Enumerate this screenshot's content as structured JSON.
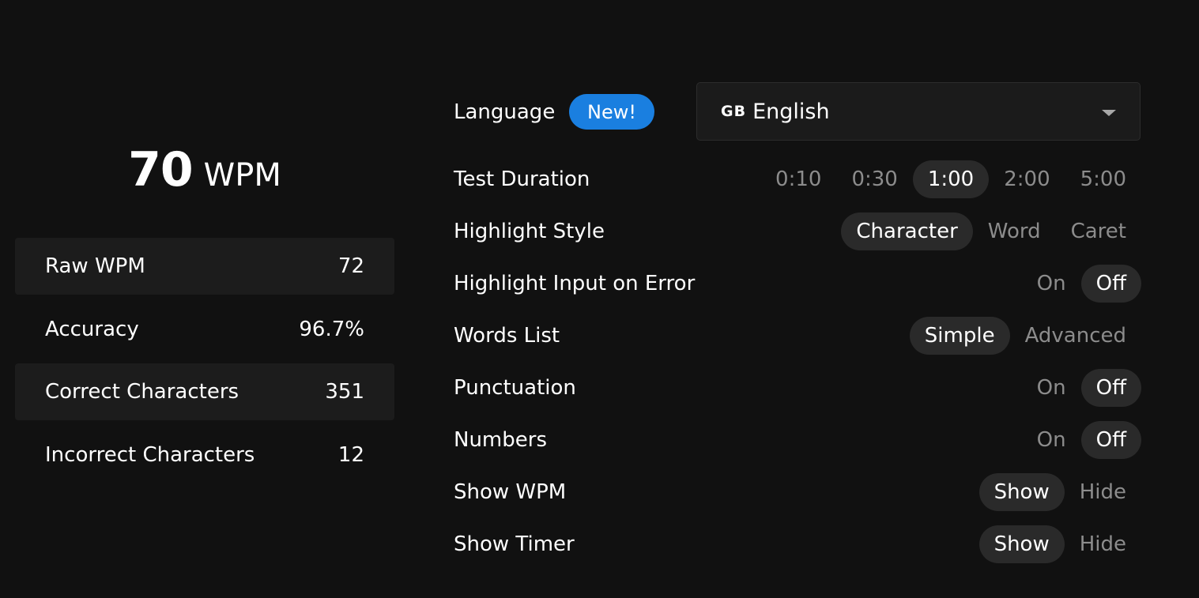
{
  "results": {
    "wpm_value": "70",
    "wpm_unit": "WPM",
    "stats": [
      {
        "label": "Raw WPM",
        "value": "72"
      },
      {
        "label": "Accuracy",
        "value": "96.7%"
      },
      {
        "label": "Correct Characters",
        "value": "351"
      },
      {
        "label": "Incorrect Characters",
        "value": "12"
      }
    ]
  },
  "settings": {
    "language": {
      "label": "Language",
      "badge": "New!",
      "flag_code": "GB",
      "selected": "English"
    },
    "test_duration": {
      "label": "Test Duration",
      "options": [
        "0:10",
        "0:30",
        "1:00",
        "2:00",
        "5:00"
      ],
      "selected": "1:00"
    },
    "highlight_style": {
      "label": "Highlight Style",
      "options": [
        "Character",
        "Word",
        "Caret"
      ],
      "selected": "Character"
    },
    "highlight_input_on_error": {
      "label": "Highlight Input on Error",
      "options": [
        "On",
        "Off"
      ],
      "selected": "Off"
    },
    "words_list": {
      "label": "Words List",
      "options": [
        "Simple",
        "Advanced"
      ],
      "selected": "Simple"
    },
    "punctuation": {
      "label": "Punctuation",
      "options": [
        "On",
        "Off"
      ],
      "selected": "Off"
    },
    "numbers": {
      "label": "Numbers",
      "options": [
        "On",
        "Off"
      ],
      "selected": "Off"
    },
    "show_wpm": {
      "label": "Show WPM",
      "options": [
        "Show",
        "Hide"
      ],
      "selected": "Show"
    },
    "show_timer": {
      "label": "Show Timer",
      "options": [
        "Show",
        "Hide"
      ],
      "selected": "Show"
    }
  },
  "colors": {
    "background": "#111111",
    "panel": "#1c1c1c",
    "active_option_bg": "#2a2a2a",
    "muted_text": "#8c8c8c",
    "accent": "#1a7fe0"
  }
}
